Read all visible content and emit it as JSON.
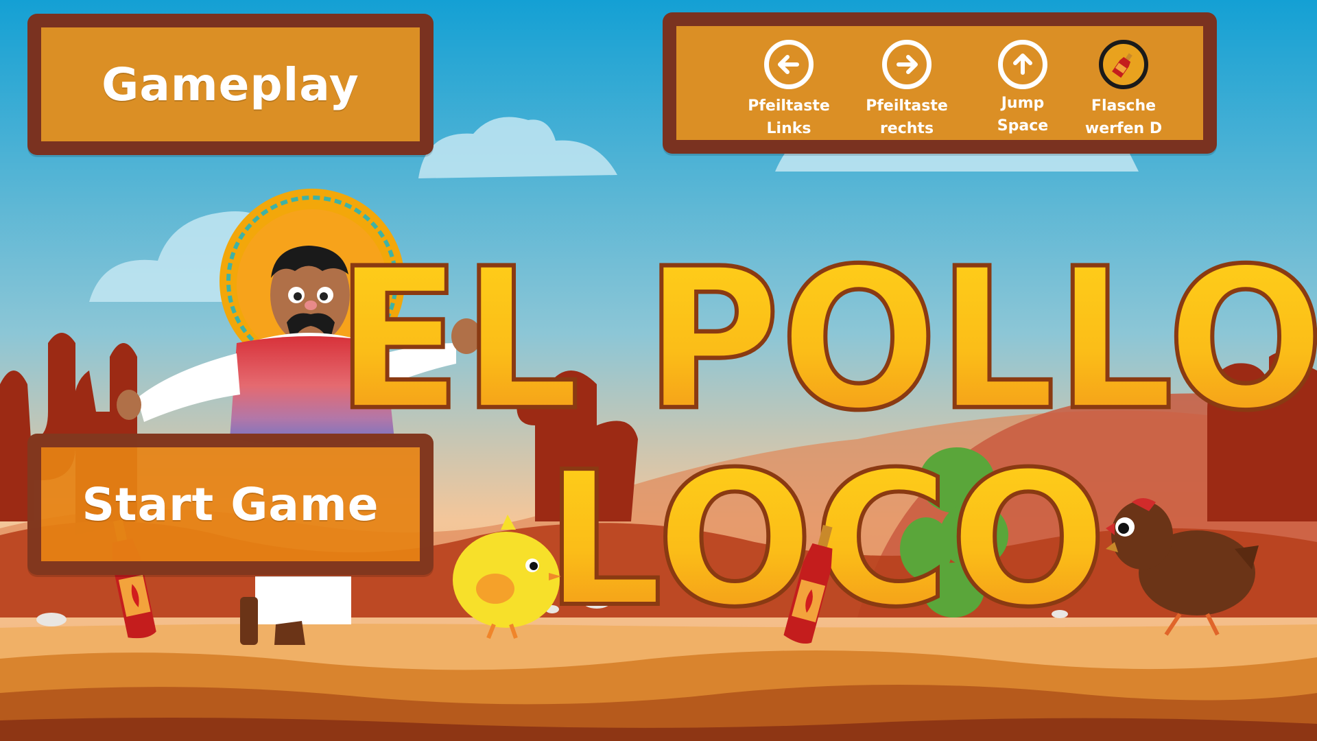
{
  "menu": {
    "gameplay_label": "Gameplay",
    "start_label": "Start Game"
  },
  "title": {
    "line1": "EL POLLO",
    "line2": "LOCO"
  },
  "controls": [
    {
      "line1": "Pfeiltaste",
      "line2": "Links",
      "icon": "arrow-left-icon"
    },
    {
      "line1": "Pfeiltaste",
      "line2": "rechts",
      "icon": "arrow-right-icon"
    },
    {
      "line1": "Jump",
      "line2": "Space",
      "icon": "arrow-up-icon"
    },
    {
      "line1": "Flasche",
      "line2": "werfen D",
      "icon": "salsa-bottle-icon"
    }
  ],
  "colors": {
    "sky_top": "#1aa0d2",
    "panel": "#db8f25",
    "panel_border": "#7a3220",
    "title_fill": "#f7c21a",
    "title_outline": "#8a3a12",
    "ground": "#e8a552",
    "cactus": "#9c2a14"
  }
}
